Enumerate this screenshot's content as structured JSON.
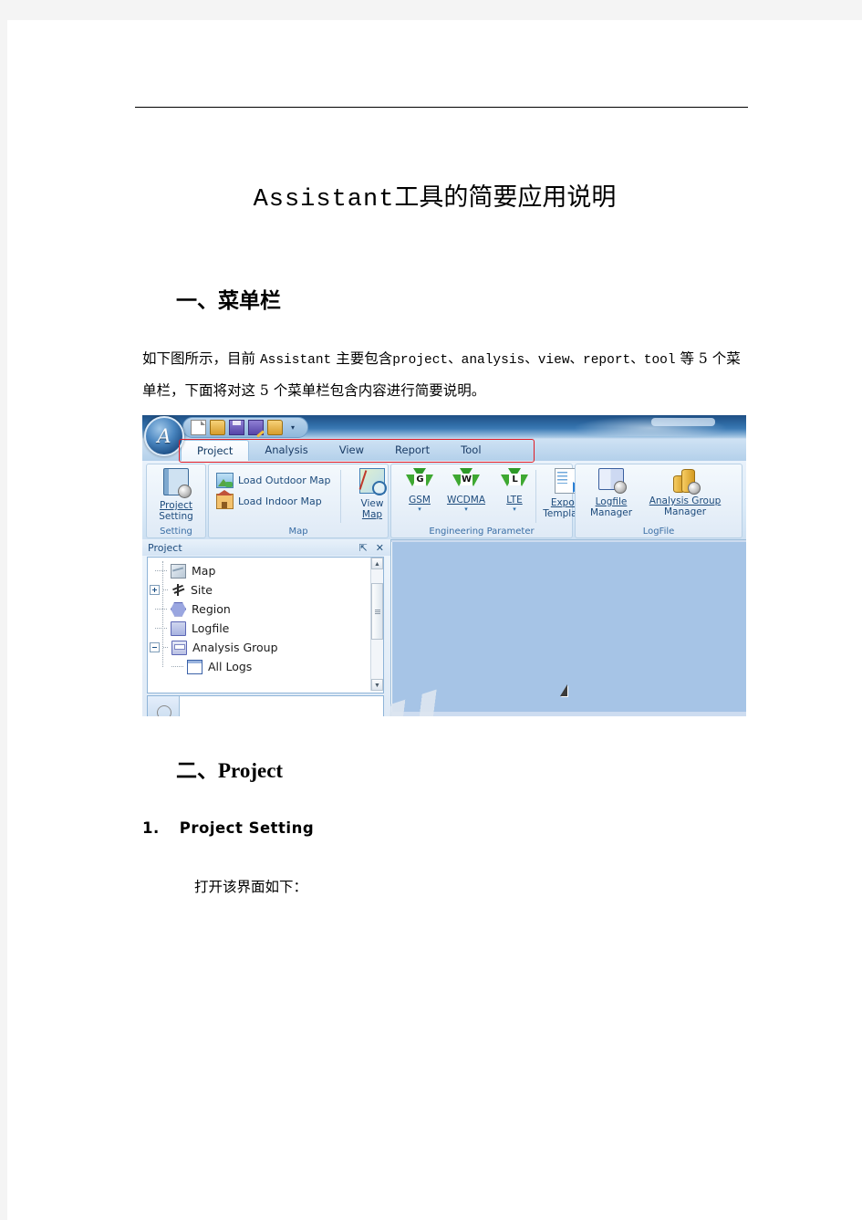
{
  "document": {
    "title_latin": "Assistant",
    "title_cjk": "工具的简要应用说明",
    "heading1": "一、菜单栏",
    "paragraph1_a": "如下图所示，目前 ",
    "paragraph1_b": "Assistant",
    "paragraph1_c": " 主要包含",
    "paragraph1_d": "project、analysis、view、report、tool",
    "paragraph1_e": " 等 5 个菜单栏，下面将对这 5 个菜单栏包含内容进行简要说明。",
    "heading2_num": "二、",
    "heading2_text": "Project",
    "heading3_num": "1.",
    "heading3_text": "Project  Setting",
    "paragraph2": "打开该界面如下："
  },
  "app": {
    "orb_label": "A",
    "quick_access": [
      {
        "name": "new-document-icon",
        "label": "New"
      },
      {
        "name": "open-folder-icon",
        "label": "Open"
      },
      {
        "name": "save-icon",
        "label": "Save"
      },
      {
        "name": "save-as-icon",
        "label": "Save As"
      },
      {
        "name": "folder-icon",
        "label": "Folder"
      }
    ],
    "qat_caret": "▾",
    "tabs": [
      {
        "label": "Project",
        "active": true
      },
      {
        "label": "Analysis",
        "active": false
      },
      {
        "label": "View",
        "active": false
      },
      {
        "label": "Report",
        "active": false
      },
      {
        "label": "Tool",
        "active": false
      }
    ],
    "annotation_color": "#e01b24",
    "groups": [
      {
        "title": "Setting",
        "items": [
          {
            "label_line1": "Project",
            "label_line2": "Setting",
            "icon": "project-setting-icon"
          }
        ]
      },
      {
        "title": "Map",
        "items": [
          {
            "label": "Load Outdoor Map",
            "icon": "load-outdoor-map-icon"
          },
          {
            "label": "Load Indoor Map",
            "icon": "load-indoor-map-icon"
          },
          {
            "label_line1": "View",
            "label_line2": "Map",
            "icon": "view-map-icon"
          }
        ]
      },
      {
        "title": "Engineering Parameter",
        "items": [
          {
            "label": "GSM",
            "icon": "gsm-antenna-icon",
            "badge": "G",
            "caret": "▾"
          },
          {
            "label": "WCDMA",
            "icon": "wcdma-antenna-icon",
            "badge": "W",
            "caret": "▾"
          },
          {
            "label": "LTE",
            "icon": "lte-antenna-icon",
            "badge": "L",
            "caret": "▾"
          },
          {
            "label_line1": "Export",
            "label_line2": "Template",
            "icon": "export-template-icon",
            "caret": "▾"
          }
        ]
      },
      {
        "title": "LogFile",
        "items": [
          {
            "label_line1": "Logfile",
            "label_line2": "Manager",
            "icon": "logfile-manager-icon"
          },
          {
            "label_line1": "Analysis Group",
            "label_line2": "Manager",
            "icon": "analysis-group-manager-icon"
          }
        ]
      }
    ],
    "panel": {
      "title": "Project",
      "pin_icon": "⇱",
      "close_icon": "✕",
      "tree": [
        {
          "label": "Map",
          "icon": "map-node-icon",
          "expander": "none",
          "indent": 0
        },
        {
          "label": "Site",
          "icon": "site-node-icon",
          "expander": "plus",
          "indent": 0
        },
        {
          "label": "Region",
          "icon": "region-node-icon",
          "expander": "none",
          "indent": 0
        },
        {
          "label": "Logfile",
          "icon": "logfile-node-icon",
          "expander": "none",
          "indent": 0
        },
        {
          "label": "Analysis Group",
          "icon": "analysis-group-node-icon",
          "expander": "minus",
          "indent": 0
        },
        {
          "label": "All Logs",
          "icon": "all-logs-node-icon",
          "expander": "none",
          "indent": 1
        }
      ],
      "scroll_up": "▲",
      "scroll_down": "▼"
    },
    "client_background": "#a6c4e6"
  }
}
